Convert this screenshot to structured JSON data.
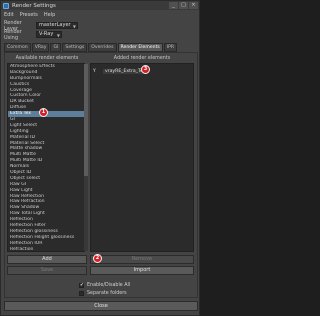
{
  "window": {
    "title": "Render Settings",
    "buttons": [
      "_",
      "□",
      "×"
    ]
  },
  "menu": [
    "Edit",
    "Presets",
    "Help"
  ],
  "render_layer": {
    "label": "Render Layer",
    "value": "masterLayer"
  },
  "render_using": {
    "label": "Render Using",
    "value": "V-Ray"
  },
  "tabs": [
    {
      "label": "Common",
      "active": false
    },
    {
      "label": "VRay",
      "active": false
    },
    {
      "label": "GI",
      "active": false
    },
    {
      "label": "Settings",
      "active": false
    },
    {
      "label": "Overrides",
      "active": false
    },
    {
      "label": "Render Elements",
      "active": true
    },
    {
      "label": "IPR",
      "active": false
    }
  ],
  "available": {
    "header": "Available render elements",
    "items": [
      "Atmosphere Effects",
      "Background",
      "Bumpnormals",
      "Caustics",
      "Coverage",
      "Custom Color",
      "DR Bucket",
      "Diffuse",
      "Extra Tex",
      "GI",
      "Light Select",
      "Lighting",
      "Material ID",
      "Material Select",
      "Matte shadow",
      "Multi Matte",
      "Multi Matte ID",
      "Normals",
      "Object ID",
      "Object select",
      "Raw GI",
      "Raw Light",
      "Raw Reflection",
      "Raw Refraction",
      "Raw Shadow",
      "Raw Total Light",
      "Reflection",
      "Reflection Filter",
      "Reflection glossiness",
      "Reflection Hilight glossiness",
      "Reflection IOR",
      "Refraction",
      "Refraction Filter",
      "Refraction glossiness",
      "Render ID"
    ],
    "selected_index": 8
  },
  "added": {
    "header": "Added render elements",
    "items": [
      {
        "visible": "Y",
        "name": "vrayRE_Extra_Tex"
      }
    ]
  },
  "buttons": {
    "add": "Add",
    "remove": "Remove",
    "save": "Save",
    "import": "Import",
    "close": "Close"
  },
  "checks": [
    {
      "label": "Enable/Disable All",
      "checked": true
    },
    {
      "label": "Separate folders",
      "checked": false
    }
  ],
  "badges": [
    "1",
    "2",
    "3"
  ],
  "colors": {
    "badge": "#d41f24",
    "selection": "#5d7f9c"
  }
}
